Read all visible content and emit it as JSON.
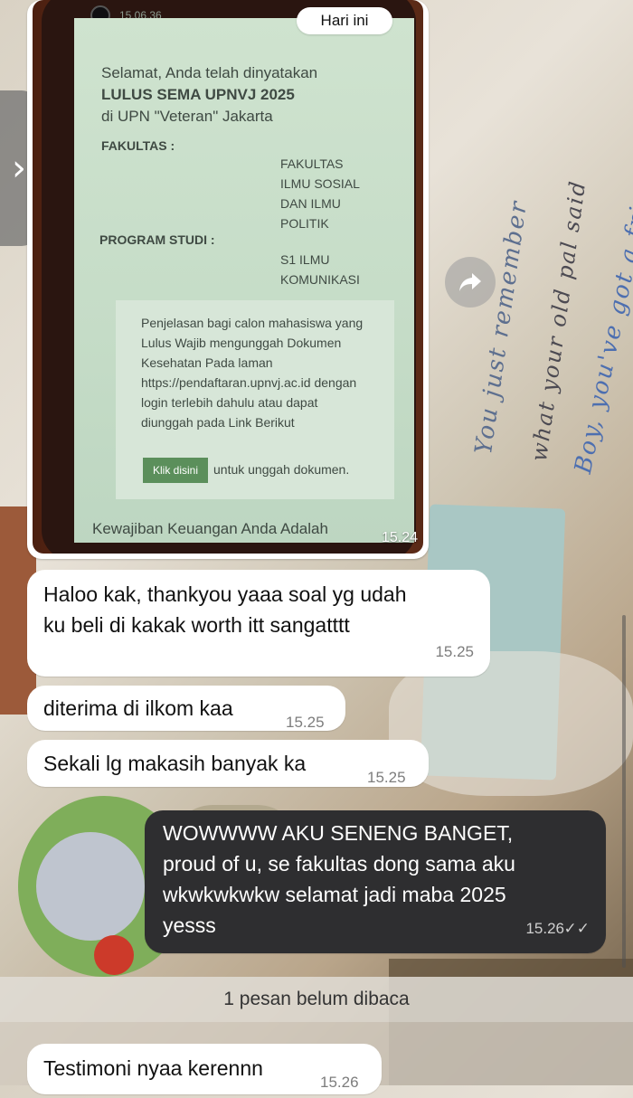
{
  "date_chip": "Hari ini",
  "image_message": {
    "status_time": "15.06.36",
    "screen_lines": {
      "congrats": "Selamat, Anda telah dinyatakan",
      "passed": "LULUS SEMA UPNVJ 2025",
      "at": "di UPN \"Veteran\" Jakarta",
      "faculty_label": "FAKULTAS :",
      "faculty_value": [
        "FAKULTAS",
        "ILMU SOSIAL",
        "DAN ILMU",
        "POLITIK"
      ],
      "program_label": "PROGRAM STUDI :",
      "program_value": [
        "S1 ILMU",
        "KOMUNIKASI"
      ],
      "note": [
        "Penjelasan bagi calon mahasiswa yang",
        "Lulus Wajib mengunggah Dokumen",
        "Kesehatan Pada laman",
        "https://pendaftaran.upnvj.ac.id dengan",
        "login terlebih dahulu atau dapat",
        "diunggah pada Link Berikut"
      ],
      "button": "Klik disini",
      "button_suffix": "untuk unggah dokumen.",
      "footer": "Kewajiban Keuangan Anda Adalah"
    },
    "time": "15.24"
  },
  "messages": [
    {
      "dir": "in",
      "lines": [
        "Haloo kak, thankyou yaaa soal yg udah",
        "ku beli di kakak worth itt sangatttt"
      ],
      "time": "15.25"
    },
    {
      "dir": "in",
      "lines": [
        "diterima di ilkom kaa"
      ],
      "time": "15.25"
    },
    {
      "dir": "in",
      "lines": [
        "Sekali lg makasih banyak ka"
      ],
      "time": "15.25"
    },
    {
      "dir": "out",
      "lines": [
        "WOWWWW AKU SENENG BANGET,",
        "proud of u, se fakultas dong sama aku",
        "wkwkwkwkw selamat jadi maba 2025",
        "yesss"
      ],
      "time": "15.26",
      "read_ticks": "✓✓"
    },
    {
      "dir": "in",
      "lines": [
        "Testimoni nyaa kerennn"
      ],
      "time": "15.26"
    }
  ],
  "unread_banner": "1 pesan belum dibaca",
  "wallpaper_text": [
    "You just remember",
    "what your old pal said",
    "Boy, you've got a friend in me"
  ],
  "icons": {
    "side_tab": "chevron-right-icon",
    "share": "forward-icon"
  },
  "colors": {
    "incoming": "#ffffff",
    "outgoing": "#2e2e30",
    "button_green": "#5b8f5b"
  }
}
